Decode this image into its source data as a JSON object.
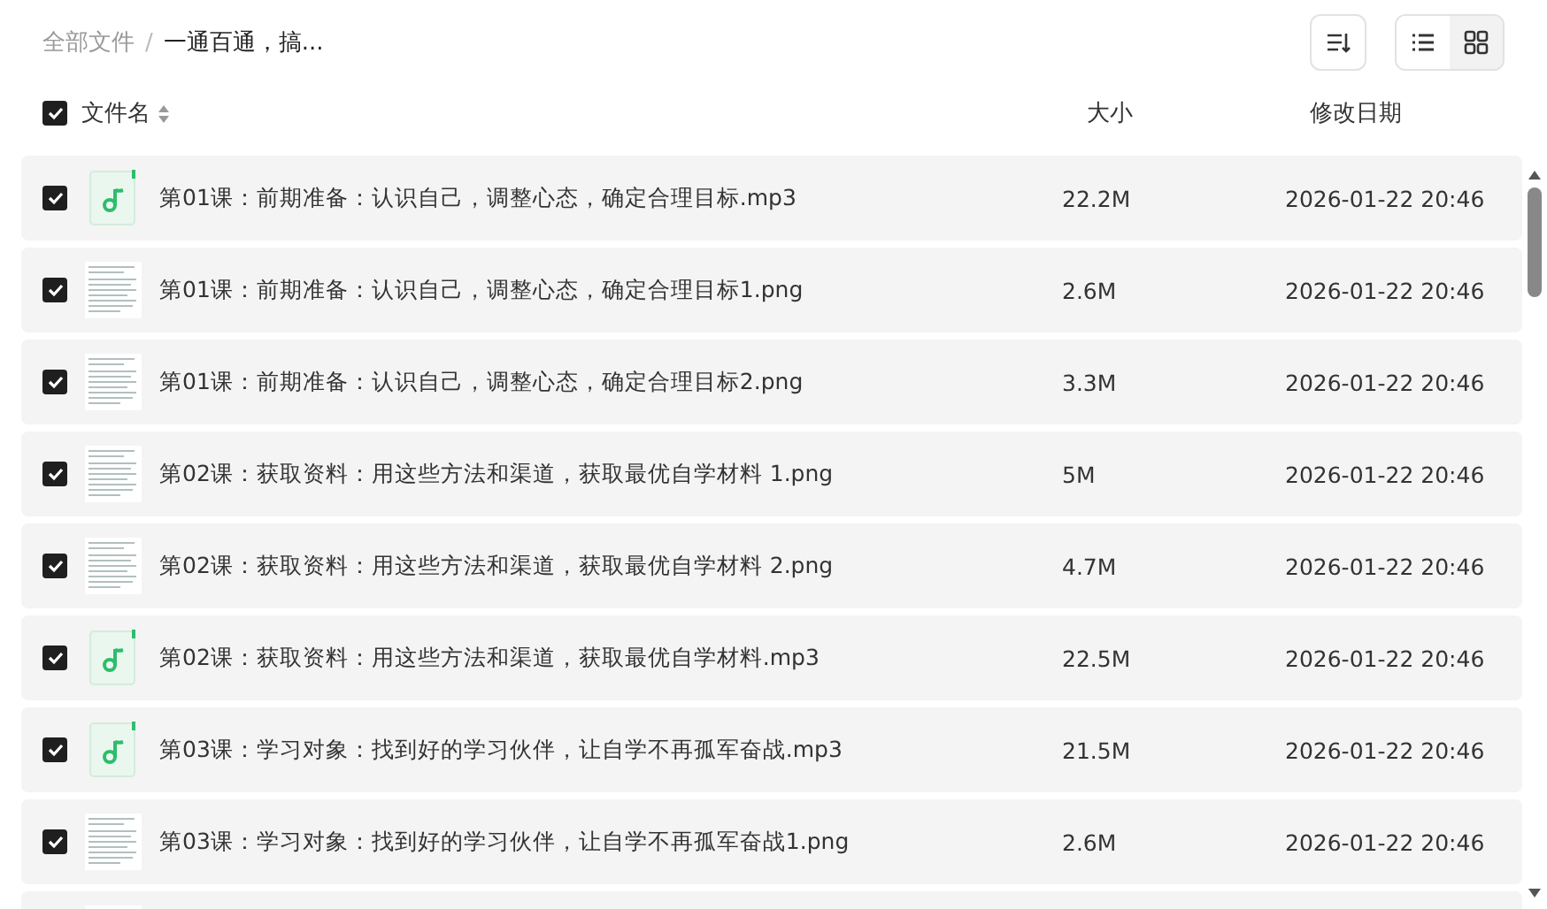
{
  "breadcrumb": [
    {
      "label": "全部文件",
      "current": false
    },
    {
      "label": "一通百通，搞...",
      "current": true
    }
  ],
  "separator": "/",
  "view_toggle": [
    {
      "kind": "list",
      "selected": false
    },
    {
      "kind": "grid",
      "selected": true
    }
  ],
  "header": {
    "checked": true,
    "name": "文件名",
    "size": "大小",
    "date": "修改日期"
  },
  "rows": [
    {
      "kind": "audio",
      "checked": true,
      "name": "第01课：前期准备：认识自己，调整心态，确定合理目标.mp3",
      "size": "22.2M",
      "date": "2026-01-22 20:46"
    },
    {
      "kind": "image",
      "checked": true,
      "name": "第01课：前期准备：认识自己，调整心态，确定合理目标1.png",
      "size": "2.6M",
      "date": "2026-01-22 20:46"
    },
    {
      "kind": "image",
      "checked": true,
      "name": "第01课：前期准备：认识自己，调整心态，确定合理目标2.png",
      "size": "3.3M",
      "date": "2026-01-22 20:46"
    },
    {
      "kind": "image",
      "checked": true,
      "name": "第02课：获取资料：用这些方法和渠道，获取最优自学材料 1.png",
      "size": "5M",
      "date": "2026-01-22 20:46"
    },
    {
      "kind": "image",
      "checked": true,
      "name": "第02课：获取资料：用这些方法和渠道，获取最优自学材料 2.png",
      "size": "4.7M",
      "date": "2026-01-22 20:46"
    },
    {
      "kind": "audio",
      "checked": true,
      "name": "第02课：获取资料：用这些方法和渠道，获取最优自学材料.mp3",
      "size": "22.5M",
      "date": "2026-01-22 20:46"
    },
    {
      "kind": "audio",
      "checked": true,
      "name": "第03课：学习对象：找到好的学习伙伴，让自学不再孤军奋战.mp3",
      "size": "21.5M",
      "date": "2026-01-22 20:46"
    },
    {
      "kind": "image",
      "checked": true,
      "name": "第03课：学习对象：找到好的学习伙伴，让自学不再孤军奋战1.png",
      "size": "2.6M",
      "date": "2026-01-22 20:46"
    },
    {
      "kind": "image"
    }
  ]
}
